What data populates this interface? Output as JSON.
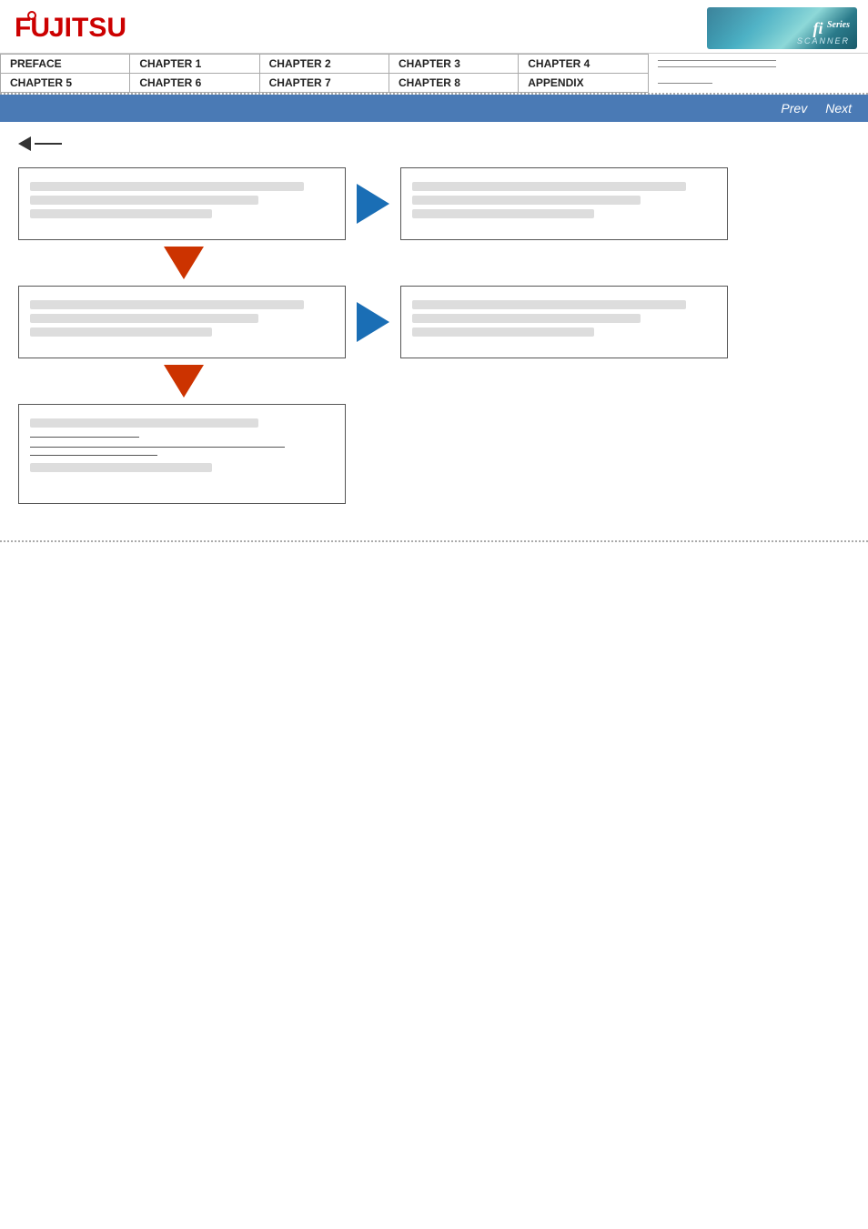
{
  "header": {
    "logo_alt": "FUJITSU",
    "fi_series_text": "fi Series"
  },
  "nav": {
    "row1": [
      "PREFACE",
      "CHAPTER 1",
      "CHAPTER 2",
      "CHAPTER 3",
      "CHAPTER 4"
    ],
    "row2": [
      "CHAPTER 5",
      "CHAPTER 6",
      "CHAPTER 7",
      "CHAPTER 8",
      "APPENDIX"
    ]
  },
  "toolbar": {
    "prev_label": "Prev",
    "next_label": "Next"
  },
  "flow": {
    "box1_left": "",
    "box1_right": "",
    "box2_left": "",
    "box2_right": "",
    "box3": "",
    "box3_link1": "",
    "box3_link2": "",
    "box3_link3": ""
  }
}
